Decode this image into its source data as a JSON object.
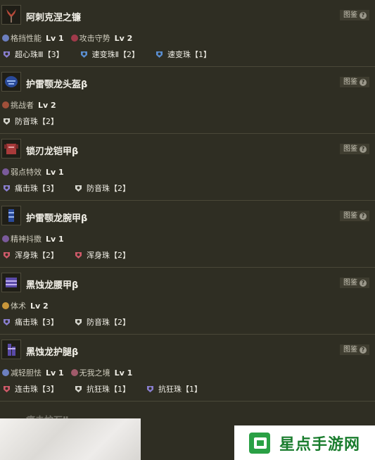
{
  "guide_label": "图鉴",
  "help_glyph": "?",
  "items": [
    {
      "name": "阿刺克涅之镰",
      "icon": "weapon-sickle-icon",
      "skills": [
        {
          "name": "格挡性能",
          "lv": "Lv 1",
          "color": "#6c7fbf"
        },
        {
          "name": "攻击守势",
          "lv": "Lv 2",
          "color": "#a03a4a"
        }
      ],
      "jewels": [
        {
          "name": "超心珠Ⅲ【3】",
          "color": "#8a7fd0",
          "icon": "jewel-purple-icon"
        },
        {
          "name": "速变珠Ⅱ【2】",
          "color": "#5a8ed0",
          "icon": "jewel-blue-icon"
        },
        {
          "name": "速变珠【1】",
          "color": "#5a8ed0",
          "icon": "jewel-blue-icon"
        }
      ]
    },
    {
      "name": "护雷颚龙头盔β",
      "icon": "helmet-icon",
      "skills": [
        {
          "name": "挑战者",
          "lv": "Lv 2",
          "color": "#a0503a"
        }
      ],
      "jewels": [
        {
          "name": "防音珠【2】",
          "color": "#d8d8d0",
          "icon": "jewel-white-icon"
        }
      ]
    },
    {
      "name": "锁刃龙铠甲β",
      "icon": "chest-armor-icon",
      "skills": [
        {
          "name": "弱点特效",
          "lv": "Lv 1",
          "color": "#7a5a9a"
        }
      ],
      "jewels": [
        {
          "name": "痛击珠【3】",
          "color": "#8a7fd0",
          "icon": "jewel-purple-icon"
        },
        {
          "name": "防音珠【2】",
          "color": "#d8d8d0",
          "icon": "jewel-white-icon"
        }
      ]
    },
    {
      "name": "护雷颚龙腕甲β",
      "icon": "arm-armor-icon",
      "skills": [
        {
          "name": "精神抖擞",
          "lv": "Lv 1",
          "color": "#7a5a9a"
        }
      ],
      "jewels": [
        {
          "name": "浑身珠【2】",
          "color": "#d05a6a",
          "icon": "jewel-red-icon"
        },
        {
          "name": "浑身珠【2】",
          "color": "#d05a6a",
          "icon": "jewel-red-icon"
        }
      ]
    },
    {
      "name": "黑蚀龙腰甲β",
      "icon": "waist-armor-icon",
      "skills": [
        {
          "name": "体术",
          "lv": "Lv 2",
          "color": "#c8963a"
        }
      ],
      "jewels": [
        {
          "name": "痛击珠【3】",
          "color": "#8a7fd0",
          "icon": "jewel-purple-icon"
        },
        {
          "name": "防音珠【2】",
          "color": "#d8d8d0",
          "icon": "jewel-white-icon"
        }
      ]
    },
    {
      "name": "黑蚀龙护腿β",
      "icon": "leg-armor-icon",
      "skills": [
        {
          "name": "减轻胆怯",
          "lv": "Lv 1",
          "color": "#6c7fbf"
        },
        {
          "name": "无我之境",
          "lv": "Lv 1",
          "color": "#a05a6a"
        }
      ],
      "jewels": [
        {
          "name": "连击珠【3】",
          "color": "#d05a6a",
          "icon": "jewel-red-icon"
        },
        {
          "name": "抗狂珠【1】",
          "color": "#d8d8d0",
          "icon": "jewel-white-icon"
        },
        {
          "name": "抗狂珠【1】",
          "color": "#8a7fd0",
          "icon": "jewel-purple-icon"
        }
      ]
    }
  ],
  "partial_item_name": "痛击护石Ⅱ",
  "watermark": {
    "text": "星点手游网",
    "color": "#1a7d2e"
  }
}
